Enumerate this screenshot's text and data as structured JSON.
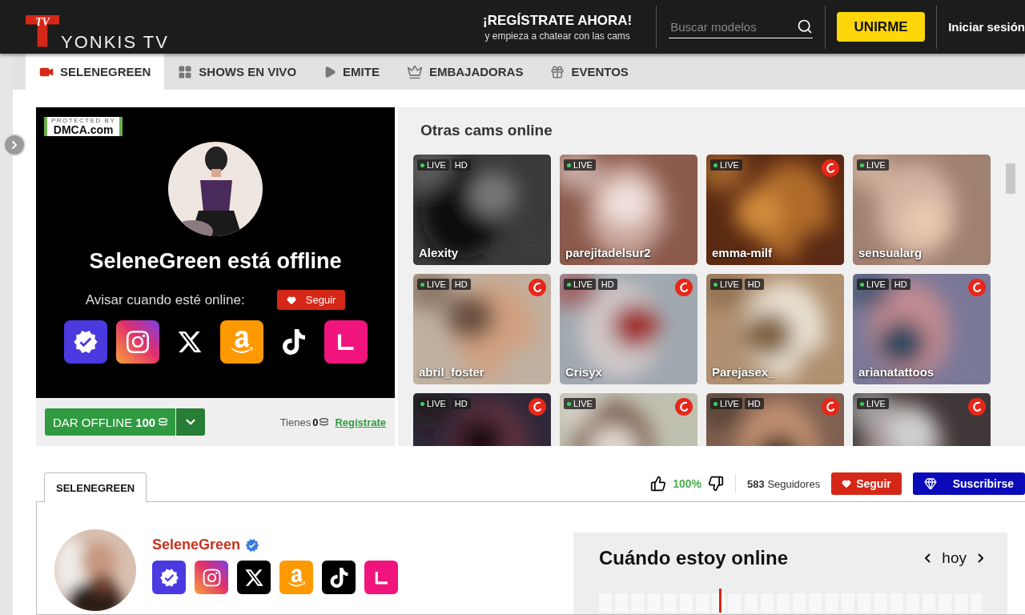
{
  "header": {
    "logo": {
      "mark": "TV",
      "text": "YONKIS TV"
    },
    "promo": {
      "title": "¡REGÍSTRATE AHORA!",
      "subtitle": "y empieza a chatear con las cams"
    },
    "search": {
      "placeholder": "Buscar modelos"
    },
    "join_button": "UNIRME",
    "login_link": "Iniciar sesión"
  },
  "nav": {
    "items": [
      {
        "label": "SELENEGREEN",
        "kind": "camera",
        "selected": true
      },
      {
        "label": "SHOWS EN VIVO",
        "kind": "grid",
        "selected": false
      },
      {
        "label": "EMITE",
        "kind": "play",
        "selected": false
      },
      {
        "label": "EMBAJADORAS",
        "kind": "crown",
        "selected": false
      },
      {
        "label": "EVENTOS",
        "kind": "gift",
        "selected": false
      }
    ]
  },
  "offline_panel": {
    "dmca": {
      "top": "PROTECTED BY",
      "bottom": "DMCA.com"
    },
    "status": "SeleneGreen está offline",
    "notify_label": "Avisar cuando esté online:",
    "follow_button": "Seguir",
    "socials": [
      {
        "kind": "verified"
      },
      {
        "kind": "instagram"
      },
      {
        "kind": "x"
      },
      {
        "kind": "amazon"
      },
      {
        "kind": "tiktok"
      },
      {
        "kind": "lemon"
      }
    ],
    "tip_button": {
      "label": "DAR OFFLINE",
      "amount": "100"
    },
    "balance": {
      "label": "Tienes",
      "amount": "0"
    },
    "register_link": "Regístrate"
  },
  "cams": {
    "title": "Otras cams online",
    "items": [
      {
        "name": "Alexity",
        "live": "LIVE",
        "quality": "HD",
        "badge": false
      },
      {
        "name": "parejitadelsur2",
        "live": "LIVE",
        "badge": false
      },
      {
        "name": "emma-milf",
        "live": "LIVE",
        "badge": true
      },
      {
        "name": "sensualarg",
        "live": "LIVE",
        "badge": false
      },
      {
        "name": "abril_foster",
        "live": "LIVE",
        "quality": "HD",
        "badge": true
      },
      {
        "name": "Crisyx",
        "live": "LIVE",
        "quality": "HD",
        "badge": true
      },
      {
        "name": "Parejasex_",
        "live": "LIVE",
        "quality": "HD",
        "badge": false
      },
      {
        "name": "arianatattoos",
        "live": "LIVE",
        "quality": "HD",
        "badge": true
      },
      {
        "live": "LIVE",
        "quality": "HD",
        "badge": true
      },
      {
        "live": "LIVE",
        "badge": true
      },
      {
        "live": "LIVE",
        "quality": "HD",
        "badge": true
      },
      {
        "live": "LIVE",
        "badge": true
      }
    ]
  },
  "profile": {
    "tab": {
      "label": "SELENEGREEN",
      "selected": true
    },
    "rating": "100%",
    "followers": {
      "count": "583",
      "label": "Seguidores"
    },
    "follow_button": "Seguir",
    "subscribe_button": "Suscribirse",
    "name": "SeleneGreen",
    "verified": true,
    "socials": [
      {
        "kind": "verified"
      },
      {
        "kind": "instagram"
      },
      {
        "kind": "x"
      },
      {
        "kind": "amazon"
      },
      {
        "kind": "tiktok"
      },
      {
        "kind": "lemon"
      }
    ],
    "schedule": {
      "title": "Cuándo estoy online",
      "day": "hoy"
    }
  }
}
